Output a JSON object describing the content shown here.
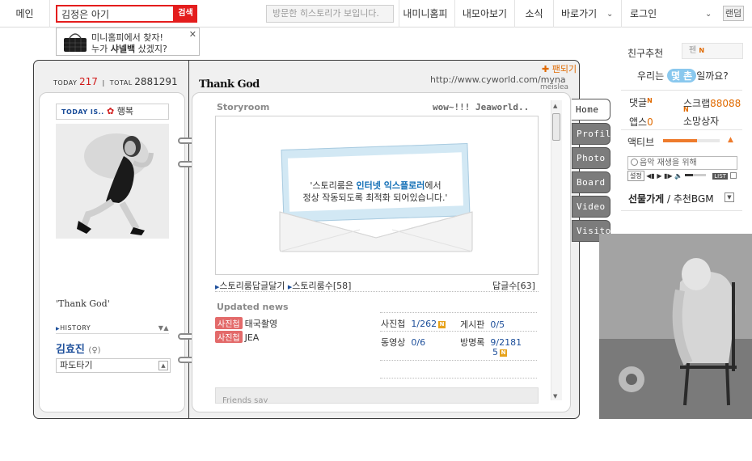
{
  "topbar": {
    "main": "메인",
    "search_value": "김정은 아기",
    "search_button": "검색",
    "visit_placeholder": "방문한 히스토리가 보입니다.",
    "links": [
      "내미니홈피",
      "내모아보기",
      "소식",
      "바로가기",
      "로그인"
    ],
    "random": "랜덤"
  },
  "tooltip": {
    "line1": "미니홈피에서 찾자!",
    "line2_pre": "누가 ",
    "line2_bold": "샤넬백",
    "line2_post": " 샀겠지?",
    "close": "✕"
  },
  "minihome": {
    "today_label": "TODAY",
    "today_count": "217",
    "total_label": "TOTAL",
    "total_count": "2881291",
    "title": "Thank God",
    "url": "http://www.cyworld.com/myna",
    "url_sub": "meislea",
    "pandoki": "✚ 팬되기",
    "today_is_label": "TODAY IS..",
    "mood": "행복",
    "quote": "'Thank God'",
    "history_label": "HISTORY",
    "owner_name": "김효진",
    "owner_sex": "(♀)",
    "select_value": "파도타기"
  },
  "storyroom": {
    "header": "Storyroom",
    "right_text": "wow~!!! Jeaworld..",
    "notice_pre": "'스토리룸은 ",
    "notice_bold": "인터넷 익스플로러",
    "notice_post": "에서",
    "notice_line2": "정상 작동되도록 최적화 되어있습니다.'",
    "link1": "스토리룸답글달기",
    "link2": "스토리룸수[58]",
    "replies": "답글수[63]"
  },
  "updated": {
    "header": "Updated news",
    "news": [
      {
        "badge": "사진첩",
        "text": "태국촬영"
      },
      {
        "badge": "사진첩",
        "text": "JEA"
      }
    ],
    "stats": [
      {
        "label": "사진첩",
        "value": "1/262",
        "new": "N"
      },
      {
        "label": "게시판",
        "value": "0/5",
        "new": ""
      },
      {
        "label": "동영상",
        "value": "0/6",
        "new": ""
      },
      {
        "label": "방명록",
        "value": "9/2181",
        "value2": "5",
        "new": "N"
      }
    ],
    "friends_header": "Friends say"
  },
  "tabs": [
    "Home",
    "Profile",
    "Photo",
    "Board",
    "Video",
    "Visitor"
  ],
  "sidebar": {
    "friend_label": "친구추천",
    "friend_select": "펜",
    "friend_new": "N",
    "us_pre": "우리는 ",
    "us_pill": "몇 촌",
    "us_post": "일까요?",
    "comments_label": "댓글",
    "comments_new": "N",
    "scrap_label": "스크랩",
    "scrap_count": "88088",
    "apps_label": "앱스",
    "apps_count": "0",
    "scrap_new": "N",
    "owner_status": "소망상자",
    "activity_label": "액티브",
    "activity_level": 0.6,
    "music_text": "음악 재생을 위해",
    "music_ctl_left": "설정",
    "music_list": "LIST",
    "gift_bold": "선물가게",
    "gift_rest": " / 추천BGM"
  },
  "colors": {
    "brand_red": "#e41d1d",
    "accent_orange": "#e06a00",
    "link_blue": "#1c4e9a"
  }
}
